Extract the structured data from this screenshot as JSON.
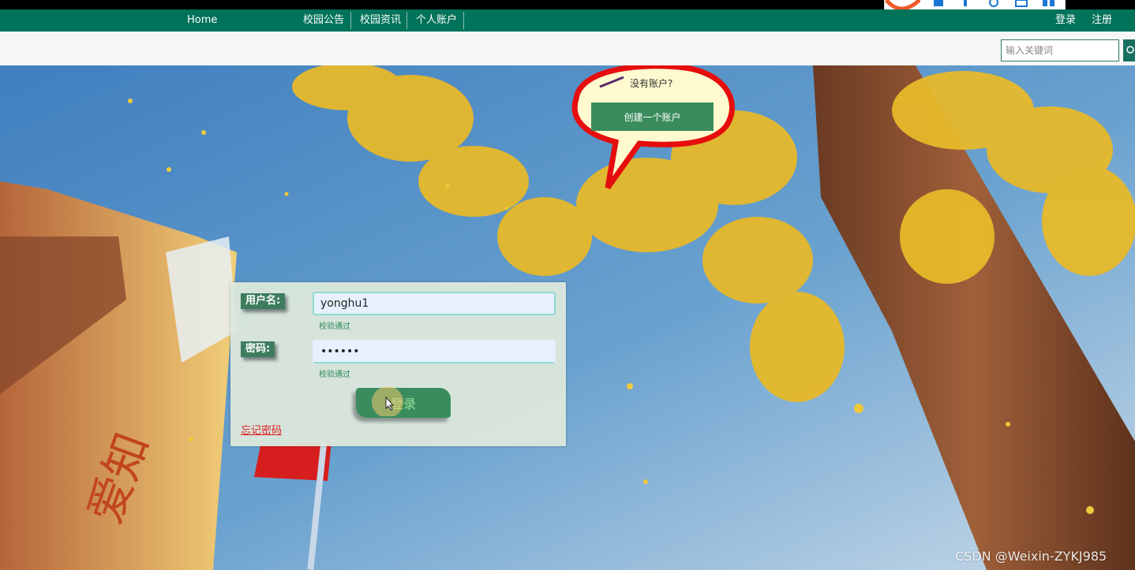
{
  "nav": {
    "home": "Home",
    "items": [
      "校园公告",
      "校园资讯",
      "个人账户"
    ],
    "login": "登录",
    "register": "注册"
  },
  "search": {
    "placeholder": "输入关键词"
  },
  "bubble": {
    "question": "没有账户?",
    "create_button": "创建一个账户"
  },
  "login_form": {
    "username_label": "用户名:",
    "username_value": "yonghu1",
    "username_hint": "校验通过",
    "password_label": "密码:",
    "password_value": "••••••",
    "password_hint": "校验通过",
    "submit": "登录",
    "forgot": "忘记密码"
  },
  "watermark": "CSDN @Weixin-ZYKJ985",
  "colors": {
    "nav_bg": "#00735a",
    "button_green": "#3a8c5d",
    "hint_green": "#2e8b57",
    "forgot_red": "#dd2222"
  }
}
